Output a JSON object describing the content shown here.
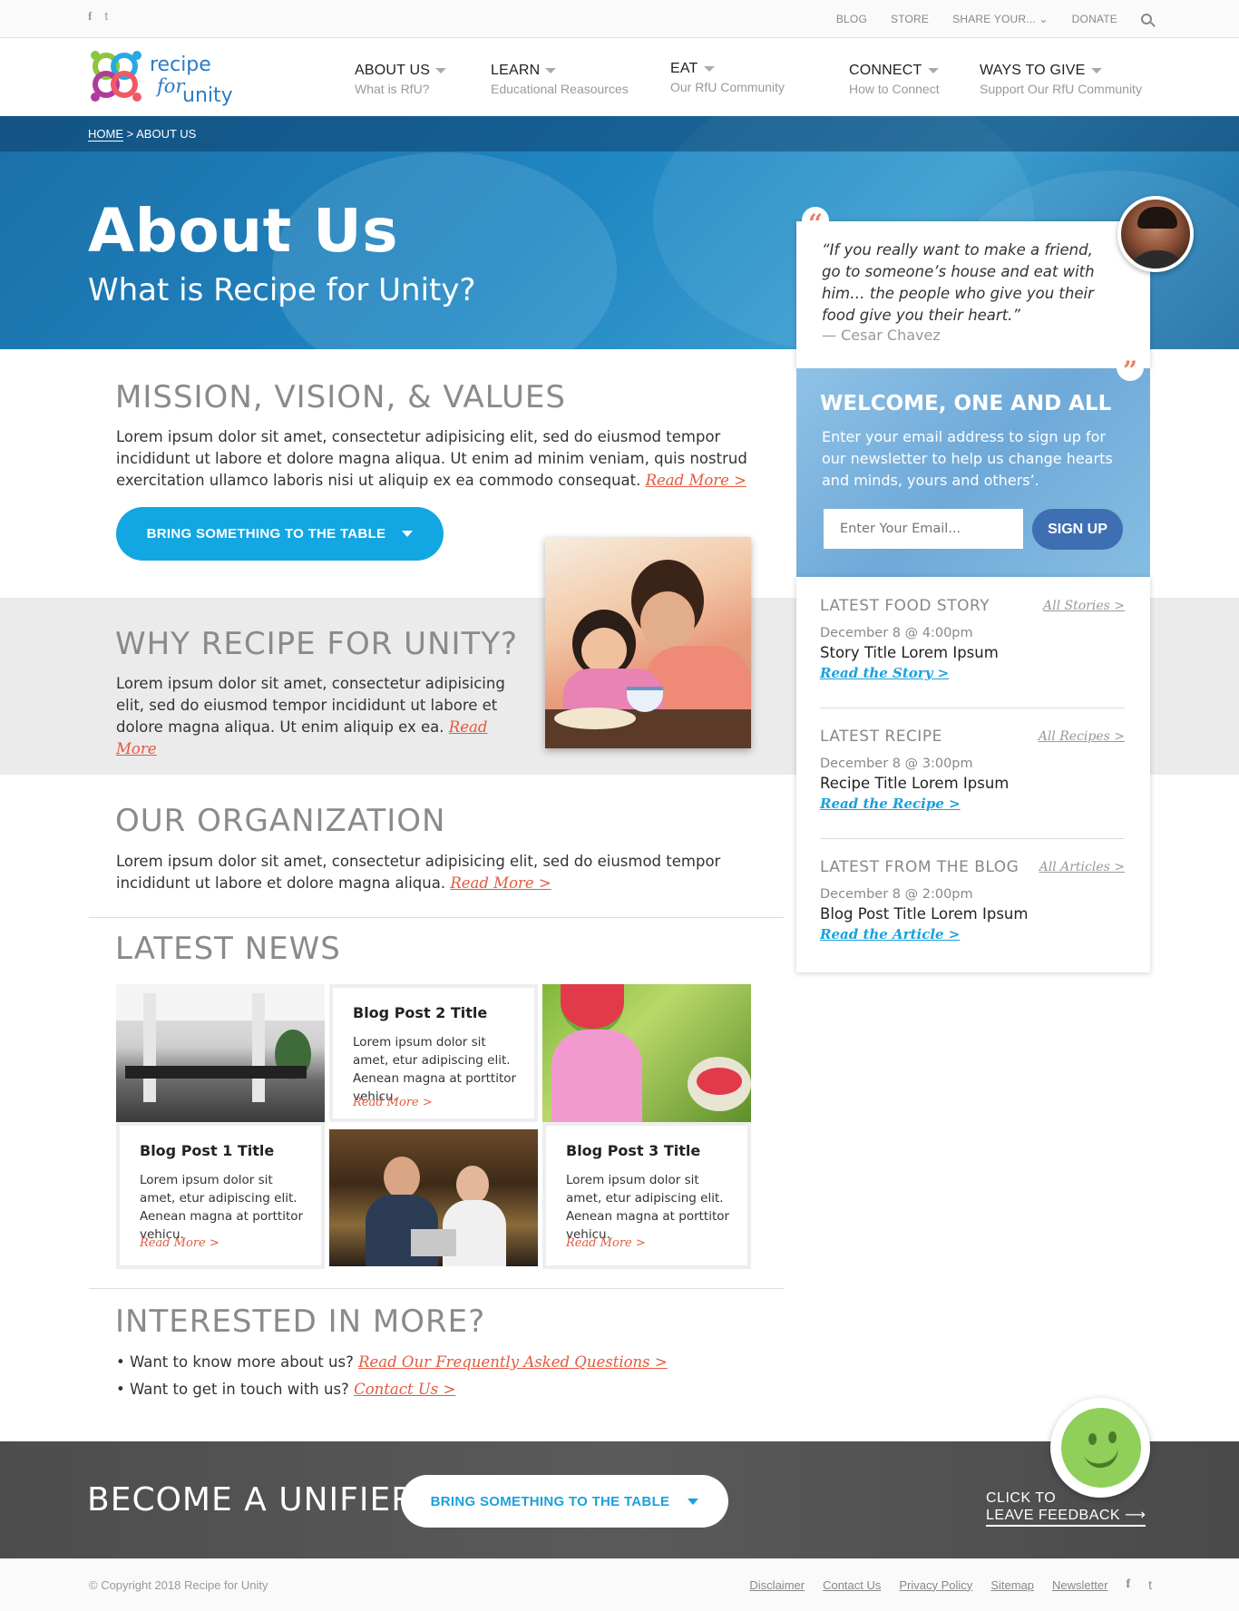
{
  "topbar": {
    "social": [
      "f",
      "t"
    ],
    "links": [
      "BLOG",
      "STORE",
      "SHARE YOUR...",
      "DONATE"
    ]
  },
  "logo": {
    "line1": "recipe",
    "line2": "for",
    "line3": "unity"
  },
  "nav": [
    {
      "label": "ABOUT US",
      "sub": "What is RfU?"
    },
    {
      "label": "LEARN",
      "sub": "Educational Reasources"
    },
    {
      "label": "EAT",
      "sub": "Our RfU Community"
    },
    {
      "label": "CONNECT",
      "sub": "How to Connect"
    },
    {
      "label": "WAYS TO GIVE",
      "sub": "Support Our RfU Community"
    }
  ],
  "breadcrumb": {
    "home": "HOME",
    "sep": " > ",
    "current": "ABOUT US"
  },
  "hero": {
    "title": "About Us",
    "subtitle": "What is Recipe for Unity?"
  },
  "mission": {
    "title": "MISSION, VISION, & VALUES",
    "body": "Lorem ipsum dolor sit amet, consectetur adipisicing elit, sed do eiusmod tempor incididunt ut labore et dolore magna aliqua. Ut enim ad minim veniam, quis nostrud exercitation ullamco laboris nisi ut aliquip ex ea commodo consequat.",
    "read_more": "Read More >",
    "cta": "BRING SOMETHING TO THE TABLE"
  },
  "why": {
    "title": "WHY RECIPE FOR UNITY?",
    "body": "Lorem ipsum dolor sit amet, consectetur adipisicing elit, sed do eiusmod tempor incididunt ut labore et dolore magna aliqua. Ut enim aliquip ex ea.",
    "read_more": "Read More"
  },
  "organization": {
    "title": "OUR ORGANIZATION",
    "body": "Lorem ipsum dolor sit amet, consectetur adipisicing elit, sed do eiusmod tempor incididunt ut labore et dolore magna aliqua.",
    "read_more": "Read More >"
  },
  "news": {
    "title": "LATEST NEWS",
    "posts": [
      {
        "title": "Blog Post 1 Title",
        "body": "Lorem ipsum dolor sit amet, etur adipiscing elit. Aenean magna at porttitor vehicu.",
        "read_more": "Read More >"
      },
      {
        "title": "Blog Post 2 Title",
        "body": "Lorem ipsum dolor sit amet, etur adipiscing elit. Aenean magna at porttitor vehicu.",
        "read_more": "Read More >"
      },
      {
        "title": "Blog Post 3 Title",
        "body": "Lorem ipsum dolor sit amet, etur adipiscing elit. Aenean magna at porttitor vehicu.",
        "read_more": "Read More >"
      }
    ]
  },
  "more": {
    "title": "INTERESTED IN MORE?",
    "q1": "• Want to know more about us?",
    "l1": "Read Our Frequently Asked Questions >",
    "q2": "• Want to get in touch with us?",
    "l2": "Contact Us >"
  },
  "quote": {
    "text": "“If you really want to make a friend, go to someone’s house and eat with him… the people who give you their food give you their heart.”",
    "author": "— Cesar Chavez",
    "open_mark": "“",
    "close_mark": "”"
  },
  "signup": {
    "title": "WELCOME, ONE AND ALL",
    "body": "Enter your email address to sign up for our newsletter to help us change hearts and minds, yours and others’.",
    "placeholder": "Enter Your Email...",
    "button": "SIGN UP"
  },
  "feed": [
    {
      "head": "LATEST FOOD STORY",
      "all": "All Stories >",
      "date": "December 8 @ 4:00pm",
      "title": "Story Title Lorem Ipsum",
      "link": "Read the Story >"
    },
    {
      "head": "LATEST RECIPE",
      "all": "All Recipes >",
      "date": "December 8 @ 3:00pm",
      "title": "Recipe Title Lorem Ipsum",
      "link": "Read the Recipe >"
    },
    {
      "head": "LATEST FROM THE BLOG",
      "all": "All Articles >",
      "date": "December 8 @ 2:00pm",
      "title": "Blog Post Title Lorem Ipsum",
      "link": "Read the Article >"
    }
  ],
  "unifier": {
    "title": "BECOME A UNIFIER",
    "cta": "BRING SOMETHING TO THE TABLE",
    "feedback1": "CLICK TO",
    "feedback2": "LEAVE FEEDBACK ⟶"
  },
  "footer": {
    "copyright": "© Copyright 2018 Recipe for Unity",
    "links": [
      "Disclaimer",
      "Contact Us",
      "Privacy Policy",
      "Sitemap",
      "Newsletter"
    ],
    "social": [
      "f",
      "t"
    ]
  },
  "colors": {
    "accent": "#12a6e3",
    "link_red": "#e35a3e",
    "signup_btn": "#3e6fb3"
  }
}
